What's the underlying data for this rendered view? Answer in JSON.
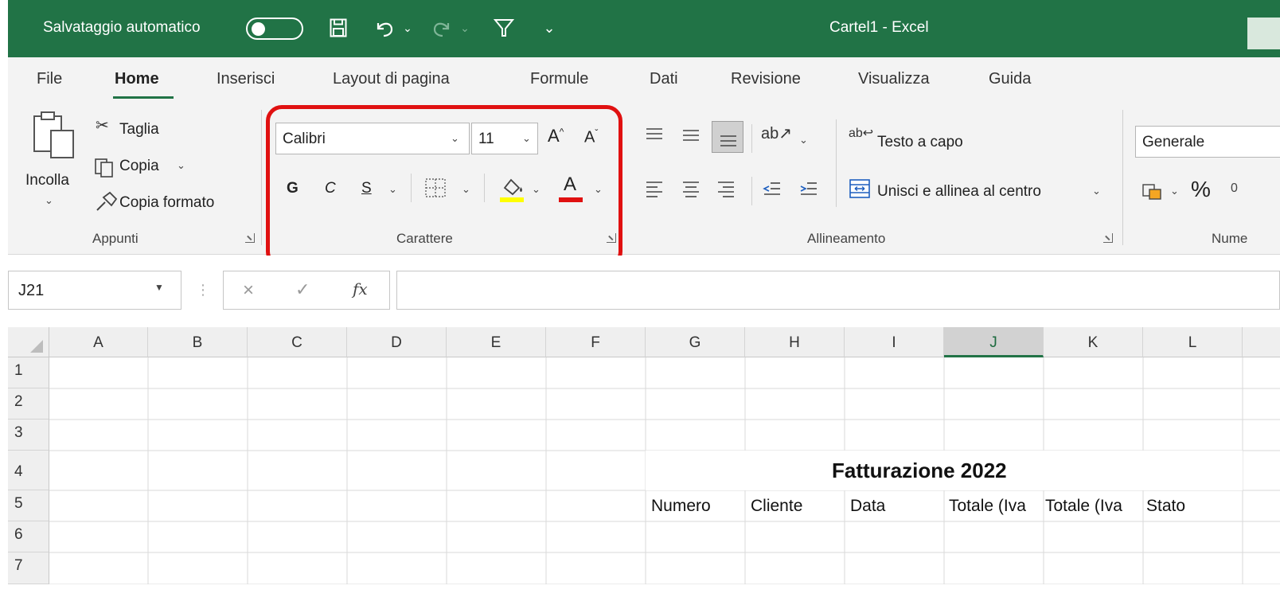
{
  "titlebar": {
    "autosave_label": "Salvataggio automatico",
    "title": "Cartel1  -  Excel"
  },
  "tabs": [
    {
      "label": "File"
    },
    {
      "label": "Home"
    },
    {
      "label": "Inserisci"
    },
    {
      "label": "Layout di pagina"
    },
    {
      "label": "Formule"
    },
    {
      "label": "Dati"
    },
    {
      "label": "Revisione"
    },
    {
      "label": "Visualizza"
    },
    {
      "label": "Guida"
    }
  ],
  "ribbon": {
    "clipboard": {
      "paste_label": "Incolla",
      "cut_label": "Taglia",
      "copy_label": "Copia",
      "format_painter_label": "Copia formato",
      "group_label": "Appunti"
    },
    "font": {
      "font_name": "Calibri",
      "font_size": "11",
      "bold_label": "G",
      "italic_label": "C",
      "underline_label": "S",
      "font_color_label": "A",
      "group_label": "Carattere",
      "fill_color": "#ffff00",
      "font_color": "#e01010"
    },
    "alignment": {
      "wrap_text_label": "Testo a capo",
      "merge_center_label": "Unisci e allinea al centro",
      "group_label": "Allineamento"
    },
    "number": {
      "format": "Generale",
      "percent_label": "%",
      "group_label": "Nume"
    }
  },
  "formula_bar": {
    "name_box": "J21",
    "fx_label": "fx",
    "formula": ""
  },
  "grid": {
    "columns": [
      "A",
      "B",
      "C",
      "D",
      "E",
      "F",
      "G",
      "H",
      "I",
      "J",
      "K",
      "L"
    ],
    "selected_column": "J",
    "rows": [
      "1",
      "2",
      "3",
      "4",
      "5",
      "6",
      "7"
    ],
    "title": "Fatturazione 2022",
    "headers": [
      "Numero",
      "Cliente",
      "Data",
      "Totale (Iva",
      "Totale (Iva",
      "Stato"
    ]
  },
  "colors": {
    "excel_green": "#217346",
    "highlight_red": "#e01010"
  }
}
